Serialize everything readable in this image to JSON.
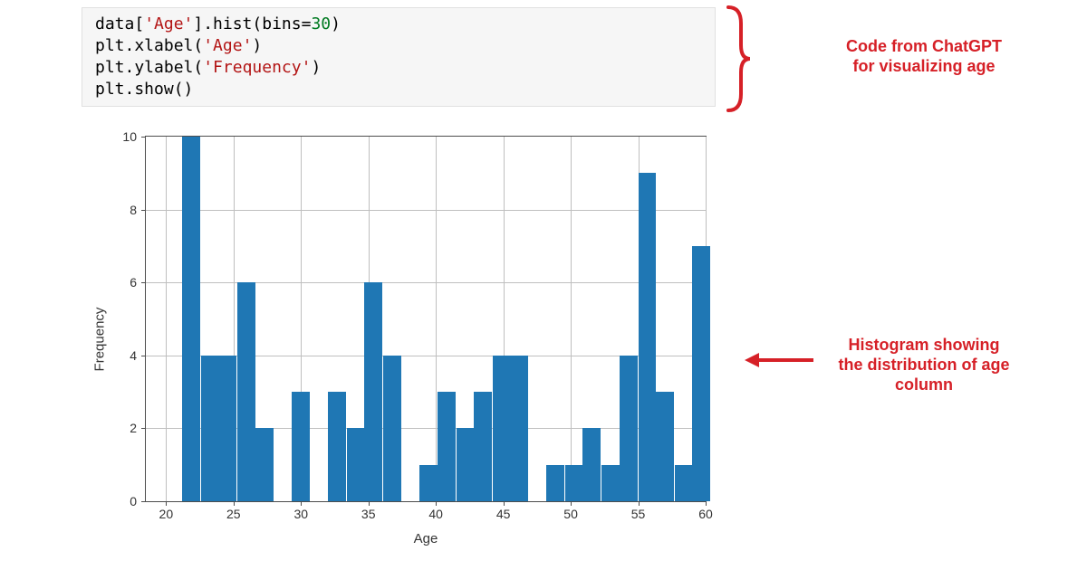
{
  "code": {
    "line1_a": "data[",
    "line1_str": "'Age'",
    "line1_b": "].hist(",
    "line1_kw": "bins",
    "line1_eq": "=",
    "line1_num": "30",
    "line1_c": ")",
    "line2_a": "plt.xlabel(",
    "line2_str": "'Age'",
    "line2_b": ")",
    "line3_a": "plt.ylabel(",
    "line3_str": "'Frequency'",
    "line3_b": ")",
    "line4": "plt.show()"
  },
  "annotations": {
    "code_caption_l1": "Code from ChatGPT",
    "code_caption_l2": "for visualizing age",
    "hist_caption_l1": "Histogram showing",
    "hist_caption_l2": "the distribution of age",
    "hist_caption_l3": "column"
  },
  "chart": {
    "xlabel": "Age",
    "ylabel": "Frequency",
    "yticks": [
      "0",
      "2",
      "4",
      "6",
      "8",
      "10"
    ],
    "xticks": [
      "20",
      "25",
      "30",
      "35",
      "40",
      "45",
      "50",
      "55",
      "60"
    ]
  },
  "chart_data": {
    "type": "bar",
    "title": "",
    "xlabel": "Age",
    "ylabel": "Frequency",
    "ylim": [
      0,
      10
    ],
    "xlim": [
      18.5,
      60
    ],
    "bin_lefts": [
      19.9,
      21.2,
      22.6,
      23.9,
      25.3,
      26.6,
      28.0,
      29.3,
      30.7,
      32.0,
      33.4,
      34.7,
      36.1,
      37.4,
      38.8,
      40.1,
      41.5,
      42.8,
      44.2,
      45.5,
      46.9,
      48.2,
      49.6,
      50.9,
      52.3,
      53.6,
      55.0,
      56.3,
      57.7,
      59.0
    ],
    "bin_width": 1.34,
    "values": [
      0,
      10,
      4,
      4,
      6,
      2,
      0,
      3,
      0,
      3,
      2,
      6,
      4,
      0,
      1,
      3,
      2,
      3,
      4,
      4,
      0,
      1,
      1,
      2,
      1,
      4,
      9,
      3,
      1,
      7
    ],
    "x_ticks": [
      20,
      25,
      30,
      35,
      40,
      45,
      50,
      55,
      60
    ],
    "y_ticks": [
      0,
      2,
      4,
      6,
      8,
      10
    ]
  }
}
